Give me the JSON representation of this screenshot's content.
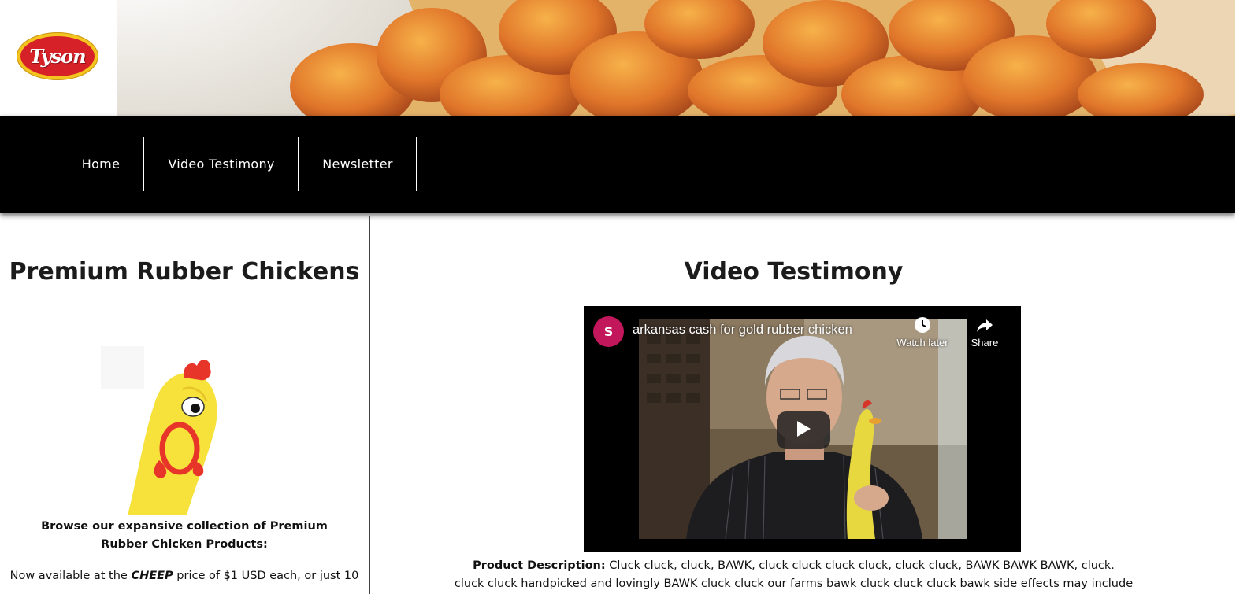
{
  "header": {
    "logo_text": "Tyson"
  },
  "nav": {
    "items": [
      {
        "label": "Home"
      },
      {
        "label": "Video Testimony"
      },
      {
        "label": "Newsletter"
      }
    ]
  },
  "sidebar": {
    "title": "Premium Rubber Chickens",
    "browse_text": "Browse our expansive collection of Premium Rubber Chicken Products:",
    "price_prefix": "Now available at the ",
    "price_emphasis": "CHEEP",
    "price_suffix": " price of $1 USD each, or just 10"
  },
  "main": {
    "title": "Video Testimony",
    "video": {
      "channel_initial": "S",
      "title": "arkansas cash for gold rubber chicken",
      "watch_later_label": "Watch later",
      "share_label": "Share"
    },
    "description_label": "Product Description:",
    "description_text": " Cluck cluck, cluck, BAWK, cluck cluck cluck cluck, cluck cluck, BAWK BAWK BAWK, cluck.",
    "description_line2": "cluck cluck handpicked and lovingly BAWK cluck cluck our farms bawk cluck cluck cluck bawk side effects may include"
  },
  "colors": {
    "nav_bg": "#000000",
    "logo_red": "#d62128",
    "logo_yellow": "#f4c51e",
    "avatar": "#c2185b"
  }
}
